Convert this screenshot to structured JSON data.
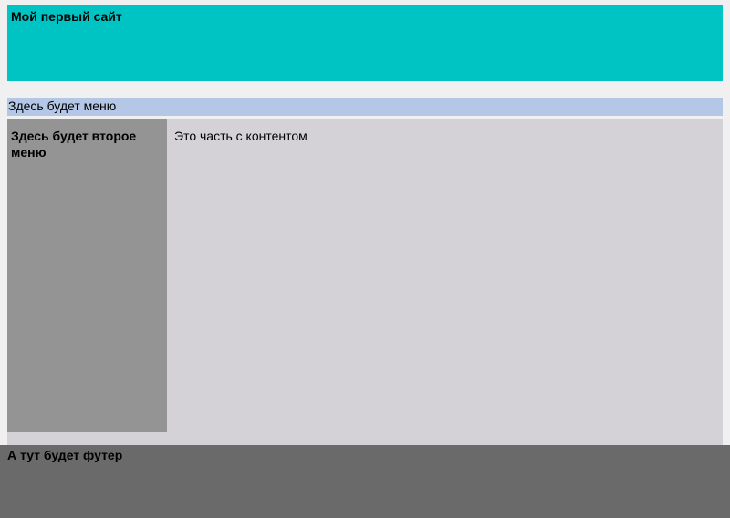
{
  "header": {
    "title": "Мой первый сайт"
  },
  "menu": {
    "label": "Здесь будет меню"
  },
  "sidebar": {
    "label": "Здесь будет второе меню"
  },
  "content": {
    "text": "Это часть с контентом"
  },
  "footer": {
    "text": "А тут будет футер"
  }
}
